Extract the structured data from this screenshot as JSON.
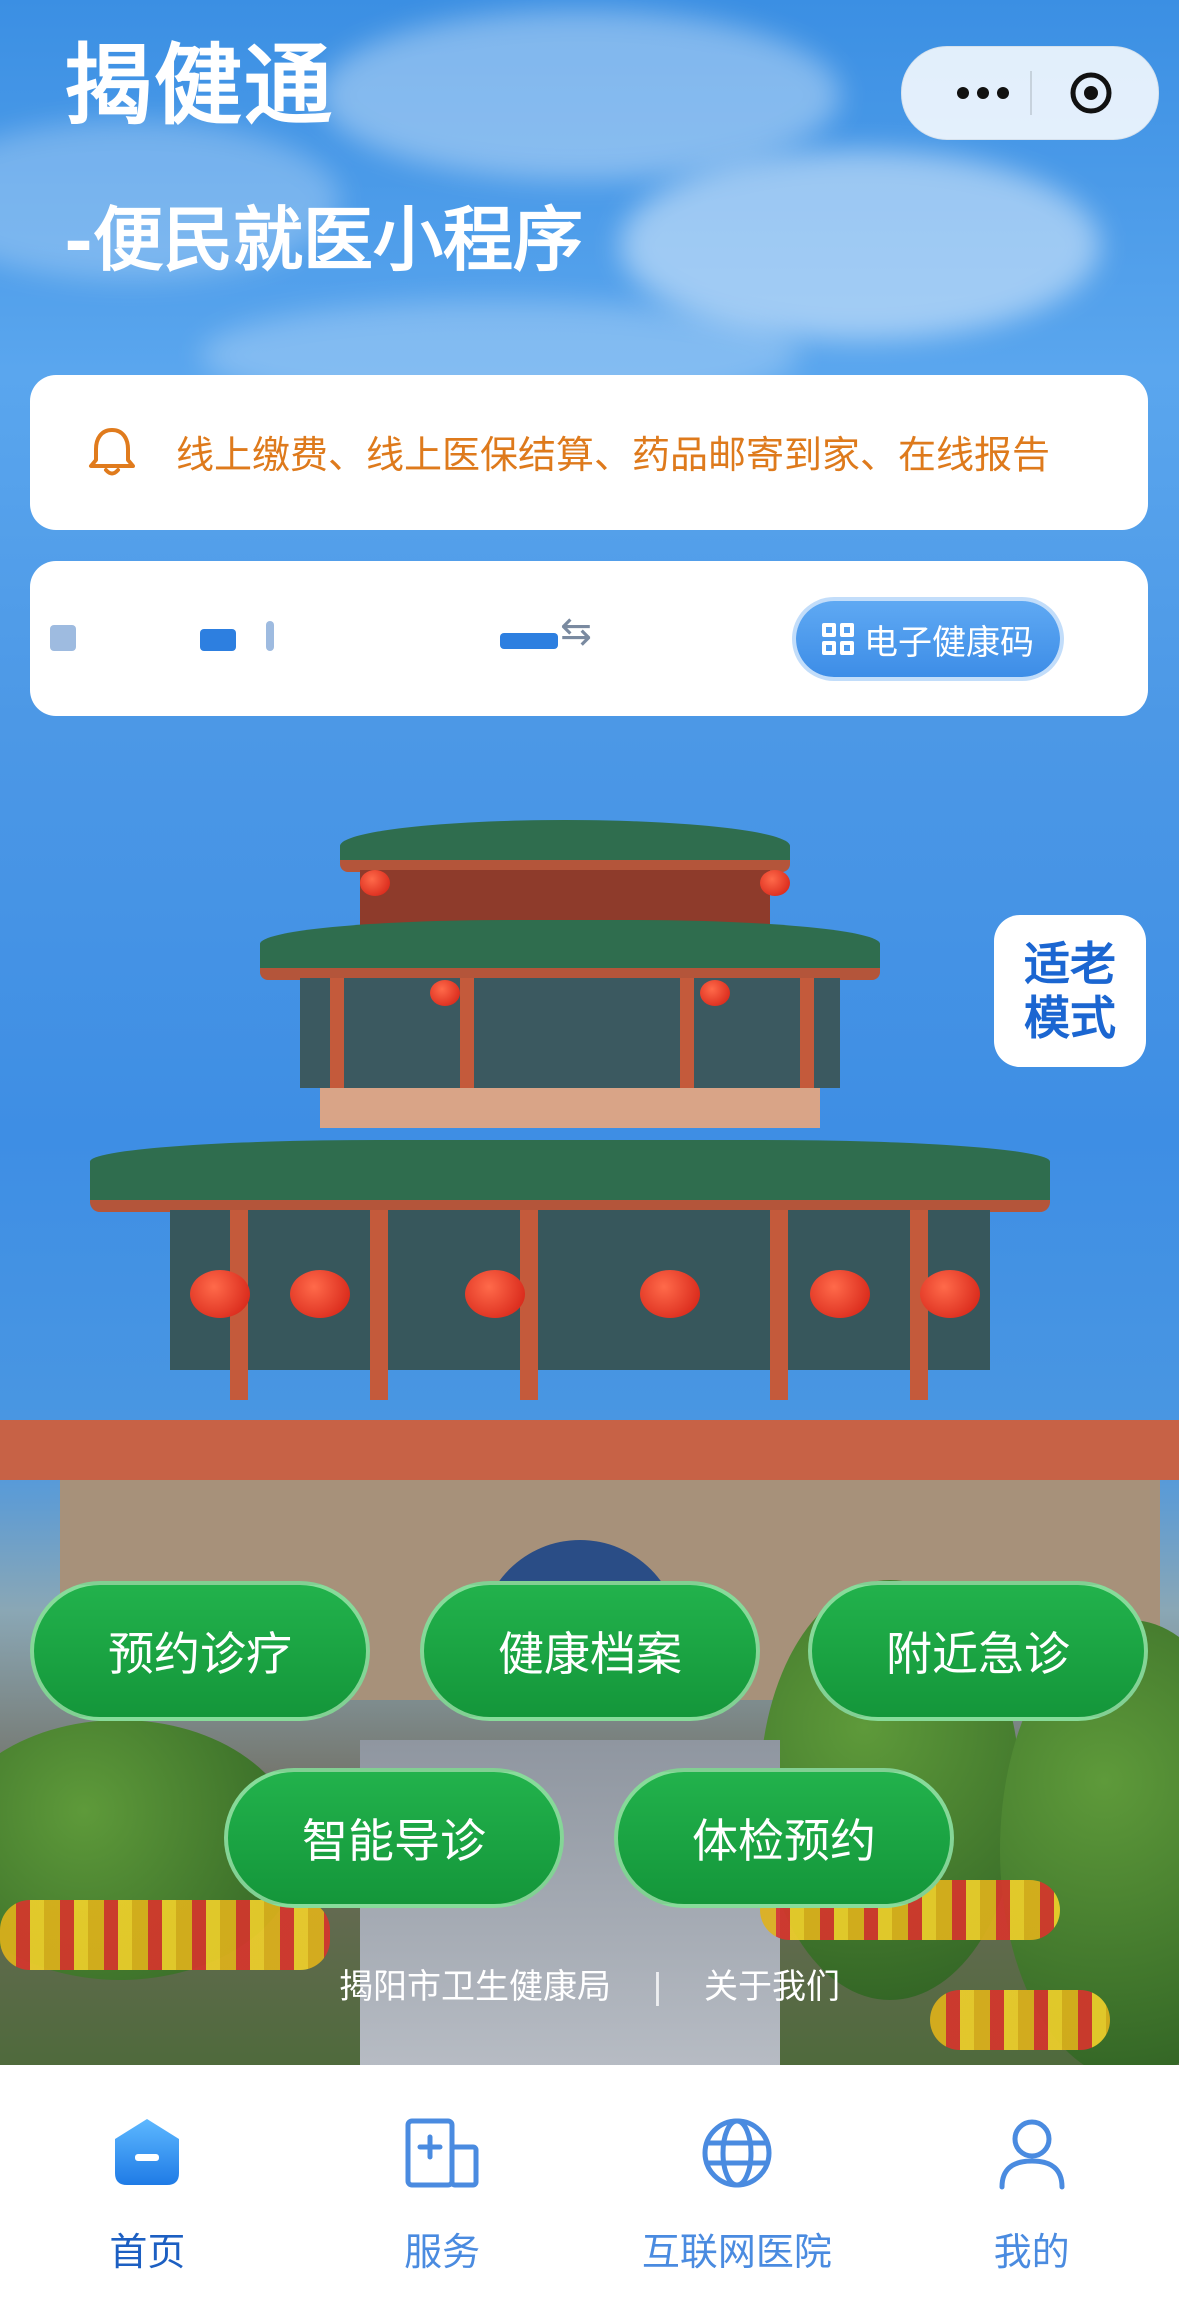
{
  "header": {
    "app_title": "揭健通",
    "subtitle": "-便民就医小程序"
  },
  "capsule": {
    "more_icon": "more-dots-icon",
    "close_icon": "target-circle-icon"
  },
  "notice": {
    "icon": "bell-icon",
    "text": "线上缴费、线上医保结算、药品邮寄到家、在线报告"
  },
  "user_bar": {
    "switch_icon": "⇆",
    "health_code_label": "电子健康码"
  },
  "elder_mode": {
    "line1": "适老",
    "line2": "模式"
  },
  "services": [
    {
      "label": "预约诊疗"
    },
    {
      "label": "健康档案"
    },
    {
      "label": "附近急诊"
    },
    {
      "label": "智能导诊"
    },
    {
      "label": "体检预约"
    }
  ],
  "footer": {
    "org": "揭阳市卫生健康局",
    "divider": "|",
    "about": "关于我们"
  },
  "tabbar": [
    {
      "label": "首页",
      "icon": "home-icon",
      "active": true
    },
    {
      "label": "服务",
      "icon": "service-icon",
      "active": false
    },
    {
      "label": "互联网医院",
      "icon": "globe-icon",
      "active": false
    },
    {
      "label": "我的",
      "icon": "user-icon",
      "active": false
    }
  ],
  "colors": {
    "accent": "#1c5fc2",
    "tab_inactive": "#4a8be0",
    "notice_text": "#de7a1c",
    "button_green": "#1aa443"
  }
}
